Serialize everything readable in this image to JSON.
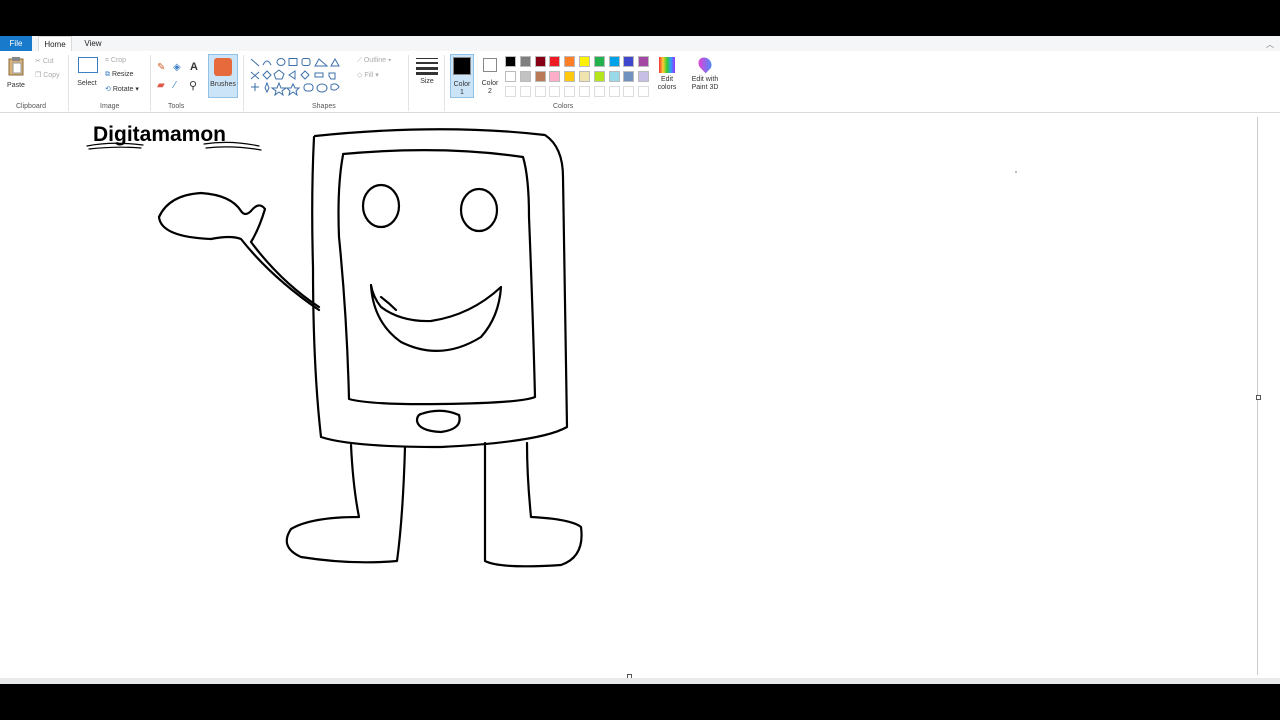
{
  "tabs": {
    "file": "File",
    "home": "Home",
    "view": "View"
  },
  "clipboard": {
    "paste": "Paste",
    "cut": "Cut",
    "copy": "Copy",
    "group": "Clipboard"
  },
  "image": {
    "select": "Select",
    "crop": "Crop",
    "resize": "Resize",
    "rotate": "Rotate",
    "group": "Image"
  },
  "tools": {
    "group": "Tools",
    "brushes": "Brushes"
  },
  "shapes": {
    "outline": "Outline",
    "fill": "Fill",
    "group": "Shapes"
  },
  "size": {
    "label": "Size"
  },
  "colors": {
    "color1": "Color 1",
    "color2": "Color 2",
    "group": "Colors",
    "edit_colors": "Edit colors",
    "edit_3d": "Edit with Paint 3D",
    "palette_row1": [
      "#000000",
      "#7f7f7f",
      "#880015",
      "#ed1c24",
      "#ff7f27",
      "#fff200",
      "#22b14c",
      "#00a2e8",
      "#3f48cc",
      "#a349a4"
    ],
    "palette_row2": [
      "#ffffff",
      "#c3c3c3",
      "#b97a57",
      "#ffaec9",
      "#ffc90e",
      "#efe4b0",
      "#b5e61d",
      "#99d9ea",
      "#7092be",
      "#c8bfe7"
    ]
  },
  "canvas": {
    "title_text": "Digitamamon"
  }
}
